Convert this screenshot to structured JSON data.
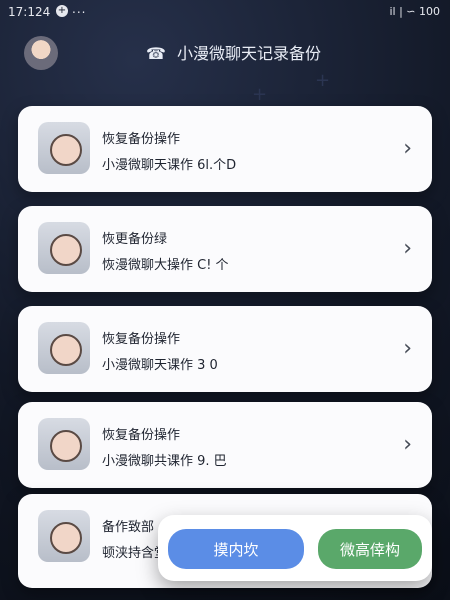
{
  "status_bar": {
    "time": "17:124",
    "plus_icon": "+",
    "dots": "...",
    "right": "il | ∽ 100"
  },
  "header": {
    "title": "小漫微聊天记录备份",
    "phone_icon": "☎"
  },
  "cards": [
    {
      "line1": "恢复备份操作",
      "line2": "小漫微聊天课作 6l.个D"
    },
    {
      "line1": "恢更备份绿",
      "line2": "恢漫微聊大操作 C! 个"
    },
    {
      "line1": "恢复备份操作",
      "line2": "小漫微聊天课作 3 0"
    },
    {
      "line1": "恢复备份操作",
      "line2": "小漫微聊共课作 9. 巴"
    },
    {
      "line1": "备作致部",
      "line2": "顿浃持含堂"
    }
  ],
  "bottom": {
    "left_button": "摸内坎",
    "right_button": "微高倖构"
  },
  "icons": {
    "chevron": "chevron-right-icon"
  }
}
